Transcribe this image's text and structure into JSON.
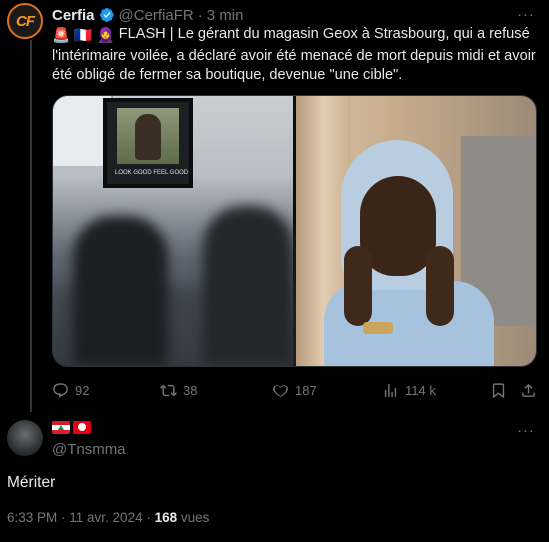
{
  "tweet": {
    "author_name": "Cerfia",
    "handle": "@CerfiaFR",
    "separator": "·",
    "time": "3 min",
    "more": "···",
    "avatar_text": "CF",
    "emoji_prefix": "🚨 🇫🇷 🧕",
    "text": "FLASH | Le gérant du magasin Geox à Strasbourg, qui a refusé l'intérimaire voilée, a déclaré avoir été menacé de mort depuis midi et avoir été obligé de fermer sa boutique, devenue \"une cible\".",
    "poster_text": "LOOK GOOD FEEL GOOD",
    "stats": {
      "replies": "92",
      "retweets": "38",
      "likes": "187",
      "views": "114 k"
    }
  },
  "reply": {
    "handle": "@Tnsmma",
    "more": "···",
    "text": "Mériter",
    "timestamp": "6:33 PM · 11 avr. 2024 ·",
    "views_count": "168",
    "views_label": "vues"
  },
  "colors": {
    "background": "#000000",
    "text": "#e7e9ea",
    "muted": "#71767b",
    "verified": "#1d9bf0",
    "border": "#2f3336"
  }
}
